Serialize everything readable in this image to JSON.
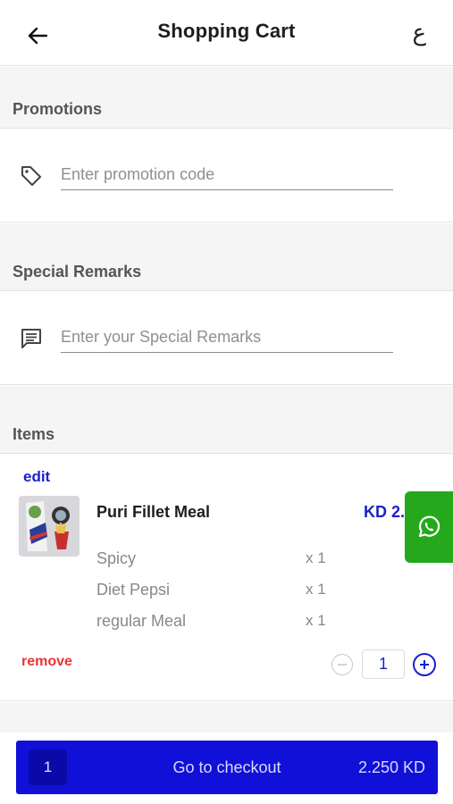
{
  "header": {
    "title": "Shopping Cart",
    "language_toggle": "ع"
  },
  "promotions": {
    "heading": "Promotions",
    "placeholder": "Enter promotion code",
    "value": ""
  },
  "remarks": {
    "heading": "Special Remarks",
    "placeholder": "Enter your Special Remarks",
    "value": ""
  },
  "items_section": {
    "heading": "Items",
    "edit_label": "edit",
    "remove_label": "remove",
    "item": {
      "name": "Puri Fillet Meal",
      "price": "KD 2.",
      "options": [
        {
          "name": "Spicy",
          "qty": "x 1"
        },
        {
          "name": "Diet Pepsi",
          "qty": "x 1"
        },
        {
          "name": "regular Meal",
          "qty": "x 1"
        }
      ],
      "quantity": "1"
    }
  },
  "checkout": {
    "count": "1",
    "label": "Go to checkout",
    "total": "2.250 KD"
  },
  "icons": {
    "back": "arrow-left-icon",
    "promo": "tag-icon",
    "remarks": "message-icon",
    "minus": "minus-circle-icon",
    "plus": "plus-circle-icon",
    "whatsapp": "whatsapp-icon"
  },
  "colors": {
    "accent": "#1a22c8",
    "checkout_bg": "#1010d8",
    "remove": "#ee3333",
    "whatsapp": "#25a81b"
  }
}
